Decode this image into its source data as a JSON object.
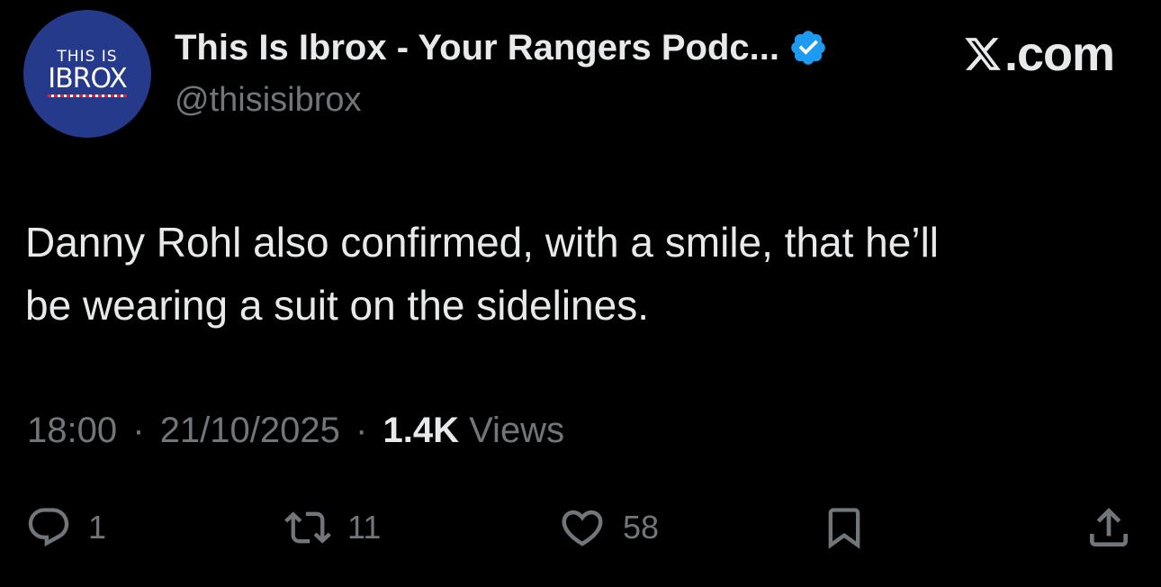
{
  "account": {
    "avatar_top": "THIS IS",
    "avatar_main": "IBROX",
    "display_name": "This Is Ibrox - Your Rangers Podc...",
    "handle": "@thisisibrox",
    "verified": true
  },
  "brand": {
    "label": ".com"
  },
  "tweet": {
    "text": "Danny Rohl also confirmed, with a smile, that he’ll\nbe wearing a suit on the sidelines.",
    "time": "18:00",
    "date": "21/10/2025",
    "separator": "·",
    "views_count": "1.4K",
    "views_label": "Views"
  },
  "actions": {
    "replies": "1",
    "reposts": "11",
    "likes": "58"
  },
  "colors": {
    "background": "#000000",
    "text": "#e7e9ea",
    "muted": "#71767b",
    "verified_blue": "#1d9bf0",
    "avatar_bg": "#263a8c"
  },
  "icons": {
    "reply": "speech-bubble-icon",
    "repost": "repost-arrows-icon",
    "like": "heart-icon",
    "bookmark": "bookmark-icon",
    "share": "share-upload-icon",
    "verified": "verified-badge-icon",
    "brand": "x-logo-icon"
  }
}
